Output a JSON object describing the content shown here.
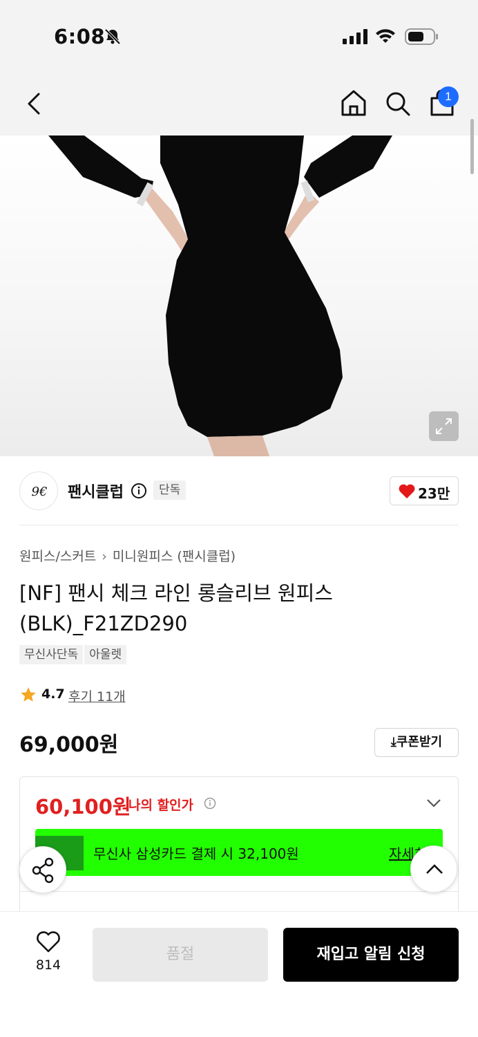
{
  "status_bar": {
    "time": "6:08",
    "icons": [
      "bell-off-icon",
      "signal-icon",
      "wifi-icon",
      "battery-icon"
    ]
  },
  "nav": {
    "icons": [
      "back-icon",
      "home-icon",
      "search-icon",
      "bag-icon"
    ],
    "cart_badge": "1"
  },
  "brand": {
    "name": "팬시클럽",
    "tag": "단독",
    "likes": "23만",
    "logo_icon": "brand-logo-icon"
  },
  "breadcrumb": {
    "category": "원피스/스커트",
    "subcategory": "미니원피스 (팬시클럽)"
  },
  "product": {
    "title": "[NF] 팬시 체크 라인 롱슬리브 원피스 (BLK)_F21ZD290",
    "tags": [
      "무신사단독",
      "아울렛"
    ],
    "rating": "4.7",
    "reviews": "후기 11개",
    "price": "69,000원",
    "coupon_label": "쿠폰받기"
  },
  "discount": {
    "my_price": "60,100원",
    "my_price_label": "나의 할인가",
    "card_text": "무신사 삼성카드 결제 시 32,100원",
    "card_more": "자세히",
    "colors": {
      "price": "#e02020",
      "banner": "#22ff00"
    }
  },
  "bottom_bar": {
    "wish_count": "814",
    "soldout_label": "품절",
    "restock_label": "재입고 알림 신청"
  }
}
